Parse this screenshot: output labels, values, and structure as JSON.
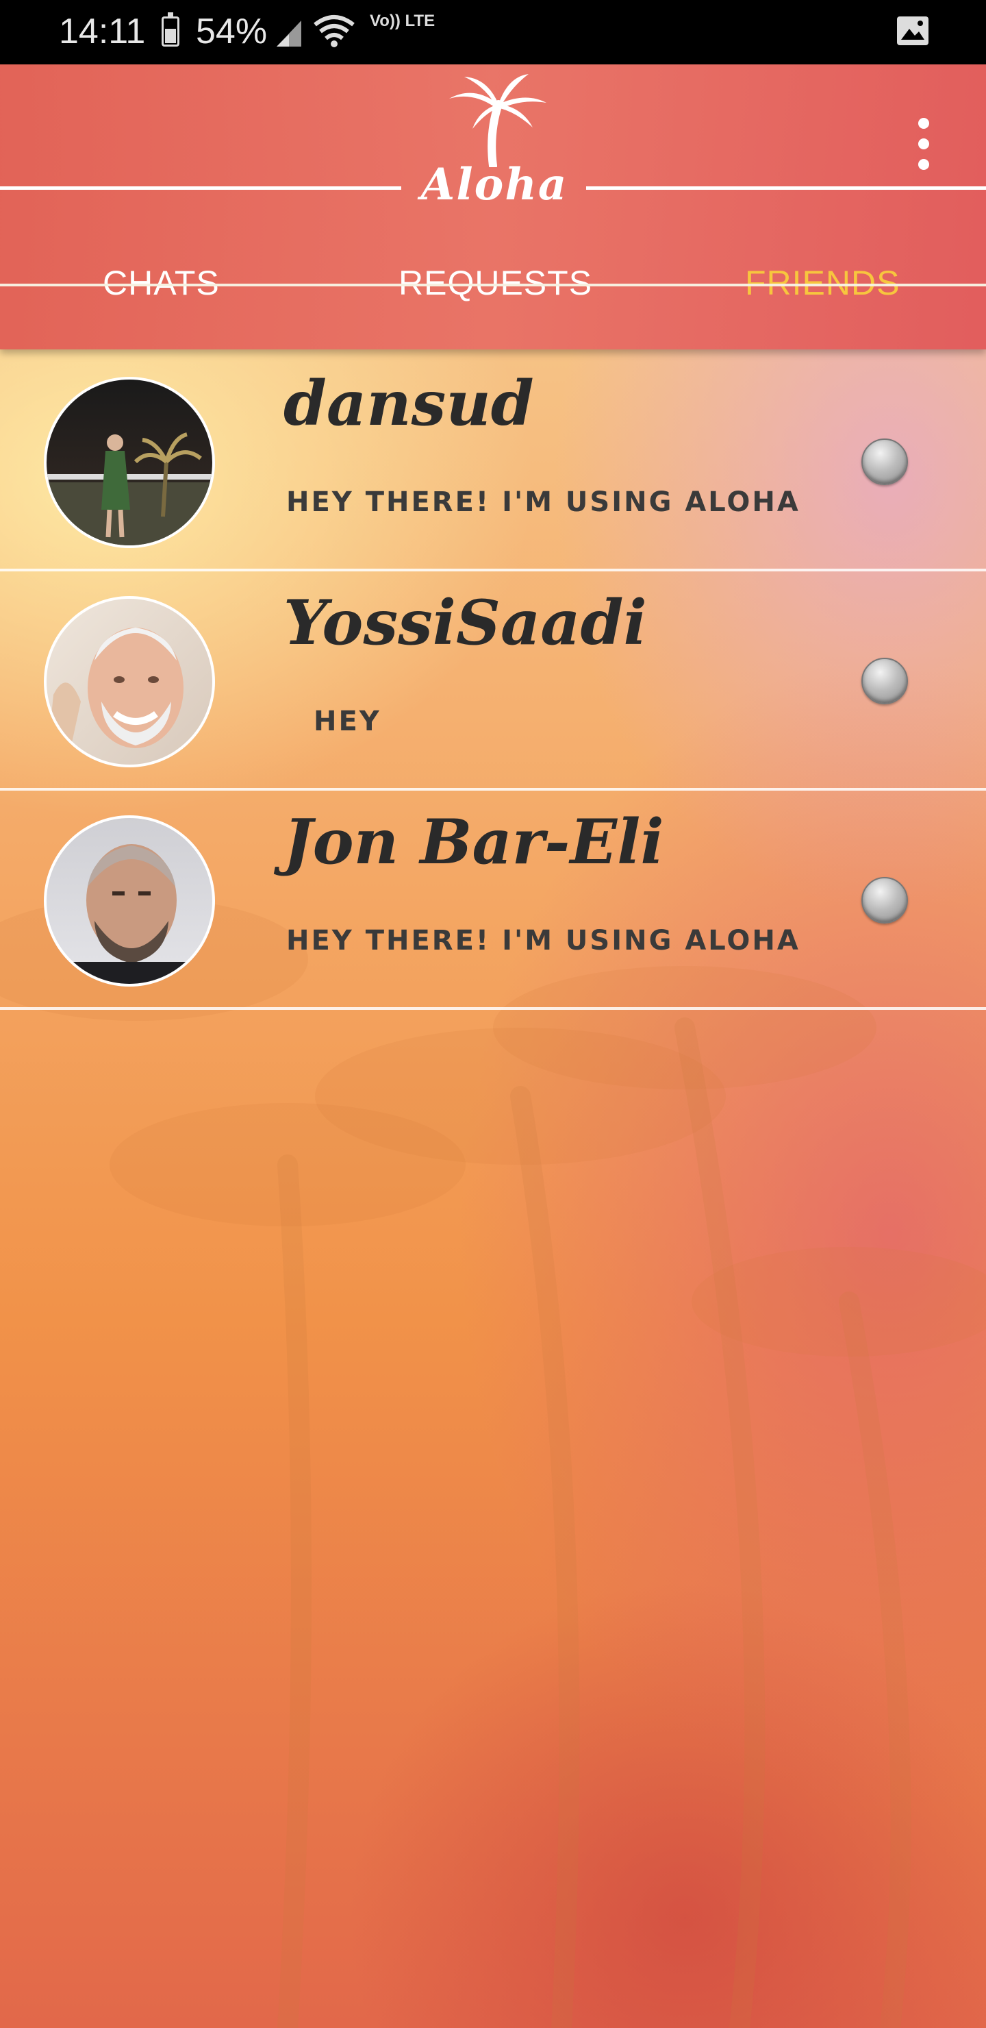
{
  "status_bar": {
    "time": "14:11",
    "battery": "54%",
    "network": "Vo)) LTE"
  },
  "app": {
    "logo_text": "Aloha",
    "brand_colors": {
      "header": "#e05f55",
      "active_tab": "#f7c63e"
    }
  },
  "tabs": [
    {
      "label": "CHATS",
      "active": false
    },
    {
      "label": "REQUESTS",
      "active": false
    },
    {
      "label": "FRIENDS",
      "active": true
    }
  ],
  "friends": [
    {
      "name": "dansud",
      "status": "HEY THERE! I'M USING ALOHA",
      "online": false
    },
    {
      "name": "YossiSaadi",
      "status": "HEY",
      "online": false
    },
    {
      "name": "Jon Bar-Eli",
      "status": "HEY THERE! I'M USING ALOHA",
      "online": false
    }
  ]
}
